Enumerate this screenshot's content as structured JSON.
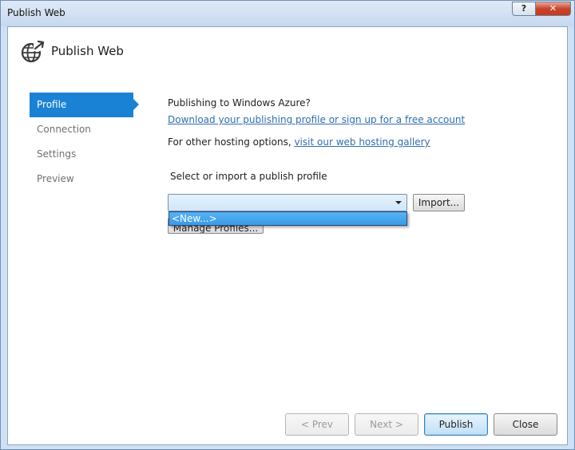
{
  "window": {
    "title": "Publish Web",
    "help_label": "?",
    "close_label": "✕"
  },
  "header": {
    "title": "Publish Web",
    "icon": "globe-arrow-icon"
  },
  "nav": {
    "items": [
      {
        "label": "Profile",
        "active": true
      },
      {
        "label": "Connection",
        "active": false
      },
      {
        "label": "Settings",
        "active": false
      },
      {
        "label": "Preview",
        "active": false
      }
    ]
  },
  "main": {
    "azure_question": "Publishing to Windows Azure?",
    "azure_link": "Download your publishing profile or sign up for a free account",
    "other_prefix": "For other hosting options, ",
    "other_link": "visit our web hosting gallery",
    "select_label": "Select or import a publish profile",
    "combo_value": "",
    "dropdown_option": "<New...>",
    "manage_label": "Manage Profiles...",
    "import_label": "Import..."
  },
  "footer": {
    "prev_label": "< Prev",
    "next_label": "Next >",
    "publish_label": "Publish",
    "close_label": "Close"
  },
  "colors": {
    "accent": "#1a82d4",
    "link": "#2f6faf",
    "dropdown_highlight": "#3a9ae8"
  }
}
